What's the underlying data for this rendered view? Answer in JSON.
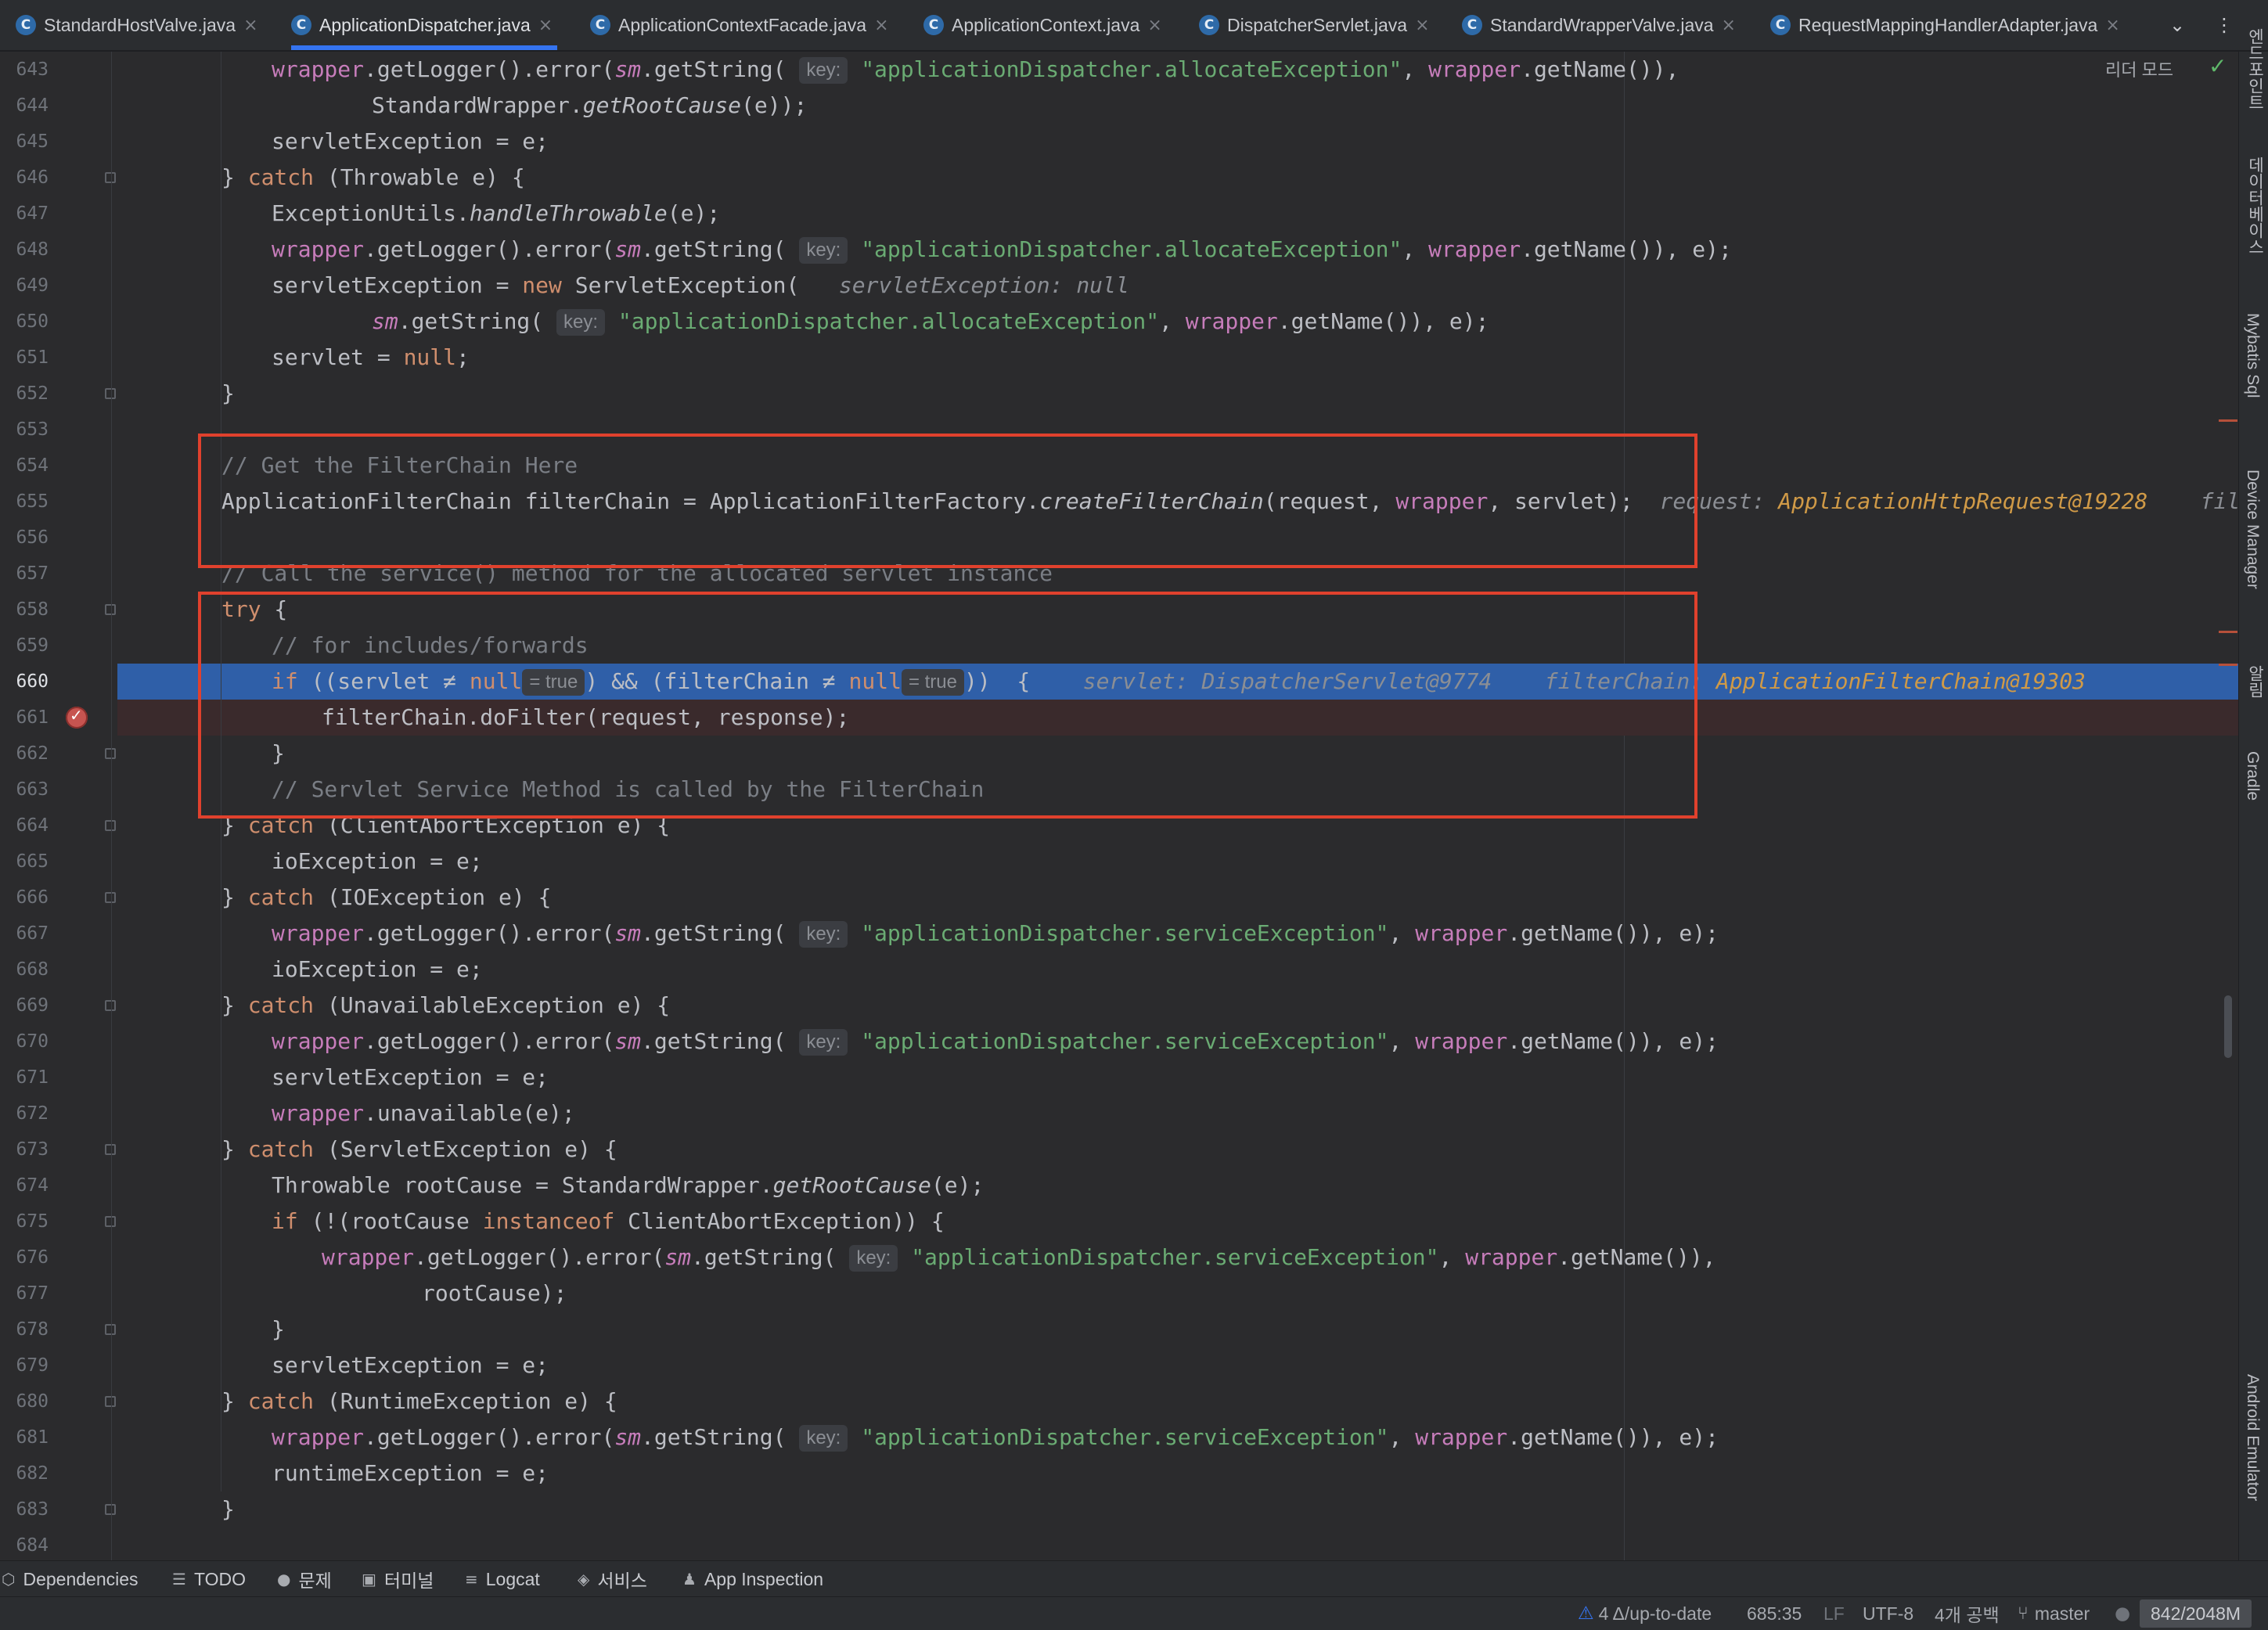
{
  "tabs": [
    {
      "label": "StandardHostValve.java",
      "active": false
    },
    {
      "label": "ApplicationDispatcher.java",
      "active": true
    },
    {
      "label": "ApplicationContextFacade.java",
      "active": false
    },
    {
      "label": "ApplicationContext.java",
      "active": false
    },
    {
      "label": "DispatcherServlet.java",
      "active": false
    },
    {
      "label": "StandardWrapperValve.java",
      "active": false
    },
    {
      "label": "RequestMappingHandlerAdapter.java",
      "active": false
    }
  ],
  "editor": {
    "reader_mode": "리더 모드",
    "line_numbers": [
      "643",
      "644",
      "645",
      "646",
      "647",
      "648",
      "649",
      "650",
      "651",
      "652",
      "653",
      "654",
      "655",
      "656",
      "657",
      "658",
      "659",
      "660",
      "661",
      "662",
      "663",
      "664",
      "665",
      "666",
      "667",
      "668",
      "669",
      "670",
      "671",
      "672",
      "673",
      "674",
      "675",
      "676",
      "677",
      "678",
      "679",
      "680",
      "681",
      "682",
      "683",
      "684"
    ],
    "current_line": "660",
    "breakpoint_line": "661",
    "hints": {
      "key": "key:",
      "true": "= true",
      "servletException_null": "servletException: null",
      "request_label": "request:",
      "request_value": "ApplicationHttpRequest@19228",
      "filterchain_label_cut": "filterChai",
      "servlet_label": "servlet:",
      "servlet_value": "DispatcherServlet@9774",
      "filterchain_label": "filterChain:",
      "filterchain_value": "ApplicationFilterChain@19303"
    },
    "code": {
      "l643_a": "wrapper",
      "l643_b": ".getLogger().error(",
      "l643_c": "sm",
      "l643_d": ".getString(",
      "s_alloc": "\"applicationDispatcher.allocateException\"",
      "s_service": "\"applicationDispatcher.serviceException\"",
      "getname": ".getName()",
      "l644": "StandardWrapper.",
      "getRootCause": "getRootCause",
      "l645": "servletException = e;",
      "catch_throwable": "(Throwable e) {",
      "l647_a": "ExceptionUtils.",
      "handleThrowable": "handleThrowable",
      "l649_a": "servletException = ",
      "l649_new": "new",
      "l649_b": " ServletException(",
      "l651_a": "servlet = ",
      "null": "null",
      "l654": "// Get the FilterChain Here",
      "l655_a": "ApplicationFilterChain filterChain = ApplicationFilterFactory.",
      "createFilterChain": "createFilterChain",
      "l655_b": "(request, ",
      "l655_c": ", servlet);",
      "l657": "// Call the service() method for the allocated servlet instance",
      "try": "try",
      "l659": "// for includes/forwards",
      "if": "if",
      "l660_a": "((servlet ≠ ",
      "l660_b": ") && (filterChain ≠ ",
      "l661": "filterChain.doFilter(request, response);",
      "l663": "// Servlet Service Method is called by the FilterChain",
      "catch": "catch",
      "c_abort": "(ClientAbortException e) {",
      "l665": "ioException = e;",
      "c_io": "(IOException e) {",
      "c_unavail": "(UnavailableException e) {",
      "l672_a": ".unavailable(e);",
      "c_servlet": "(ServletException e) {",
      "l674": "Throwable rootCause = StandardWrapper.",
      "l675_a": "(!(rootCause ",
      "instanceof": "instanceof",
      "l675_b": " ClientAbortException)) {",
      "l677": "rootCause);",
      "c_runtime": "(RuntimeException e) {",
      "l682": "runtimeException = e;"
    }
  },
  "right_tools": [
    "엔드포인트",
    "데이터베이스",
    "Mybatis Sql",
    "Device Manager",
    "알림",
    "Gradle",
    "Android Emulator"
  ],
  "tool_windows": [
    {
      "label": "Dependencies",
      "icon": "dependencies-icon"
    },
    {
      "label": "TODO",
      "icon": "list-icon"
    },
    {
      "label": "문제",
      "icon": "info-icon"
    },
    {
      "label": "터미널",
      "icon": "terminal-icon"
    },
    {
      "label": "Logcat",
      "icon": "logcat-icon"
    },
    {
      "label": "서비스",
      "icon": "services-icon"
    },
    {
      "label": "App Inspection",
      "icon": "inspection-icon"
    }
  ],
  "status": {
    "vcs_changes": "4 Δ/up-to-date",
    "position": "685:35",
    "line_sep": "LF",
    "encoding": "UTF-8",
    "indent": "4개 공백",
    "branch": "master",
    "memory": "842/2048M"
  },
  "colors": {
    "accent": "#3574f0",
    "current_line": "#2f5fa8",
    "breakpoint_row": "#3a2a2c",
    "highlight_box": "#e0412d"
  }
}
